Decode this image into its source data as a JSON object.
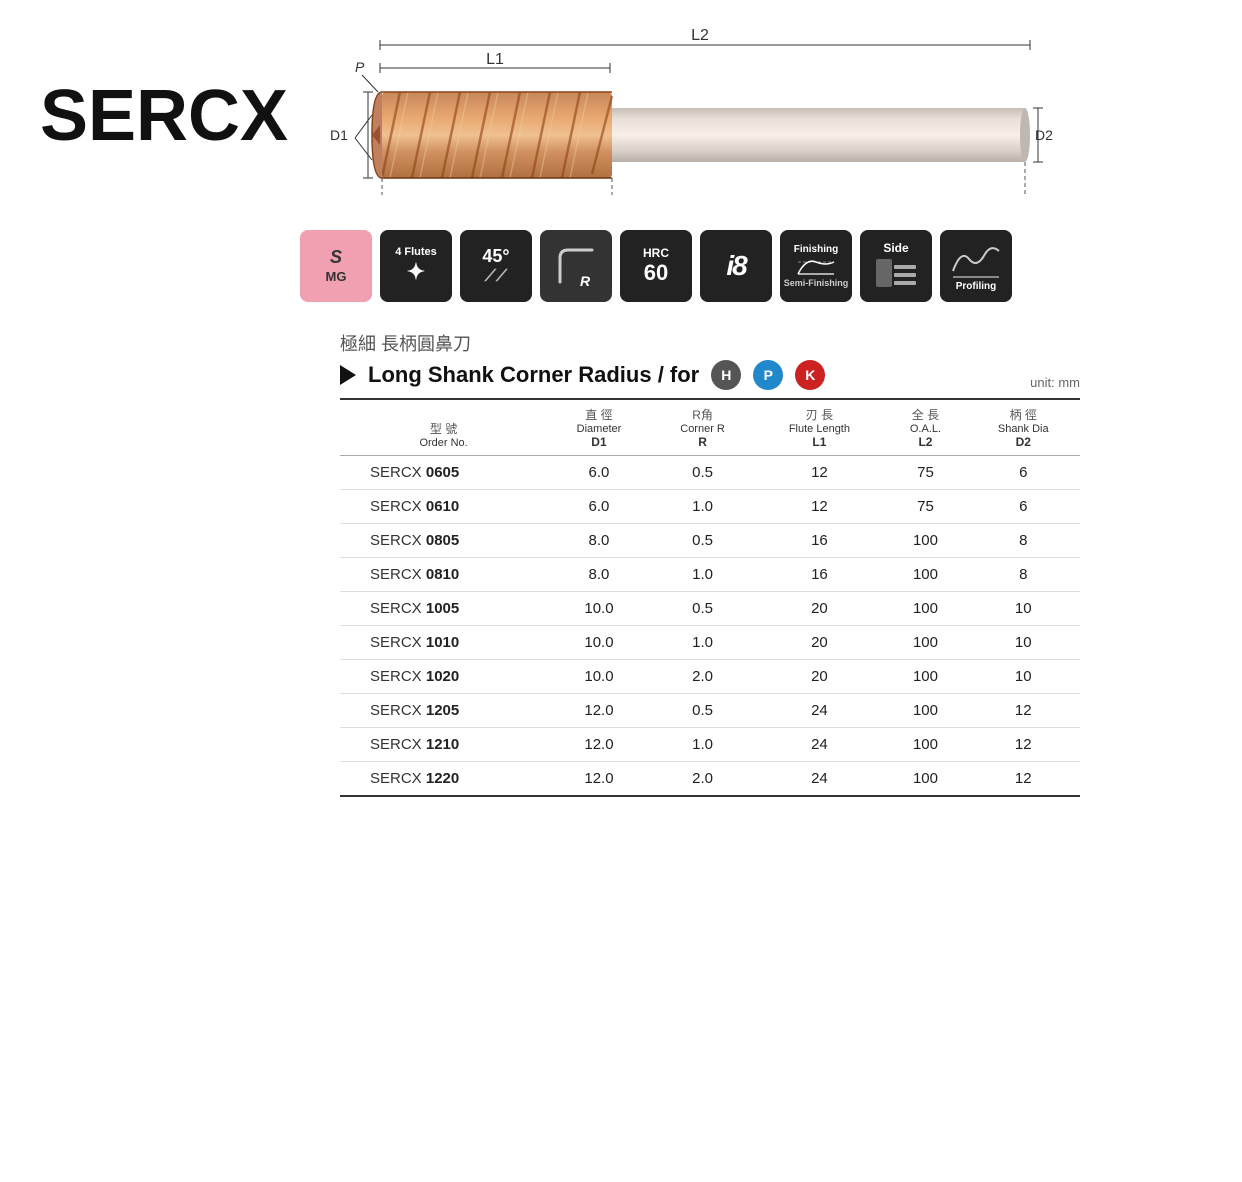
{
  "brand": "SERCX",
  "badges": [
    {
      "id": "s-mg",
      "line1": "S",
      "line2": "MG",
      "style": "pink"
    },
    {
      "id": "4-flutes",
      "line1": "4 Flutes",
      "line2": "⚙",
      "style": "dark"
    },
    {
      "id": "45deg",
      "line1": "45°",
      "line2": "//",
      "style": "dark"
    },
    {
      "id": "corner-r",
      "line1": "",
      "line2": "R",
      "style": "dark"
    },
    {
      "id": "hrc60",
      "line1": "HRC",
      "line2": "60",
      "style": "dark"
    },
    {
      "id": "i8",
      "line1": "i",
      "line2": "8",
      "style": "dark"
    },
    {
      "id": "finishing",
      "line1": "Finishing",
      "line2": "Semi-Finishing",
      "style": "dark"
    },
    {
      "id": "side",
      "line1": "Side",
      "line2": "",
      "style": "dark"
    },
    {
      "id": "profiling",
      "line1": "Profiling",
      "line2": "",
      "style": "dark"
    }
  ],
  "chinese_title": "極細  長柄圓鼻刀",
  "product_title": "Long Shank Corner Radius / for",
  "circles": [
    "H",
    "P",
    "K"
  ],
  "unit": "unit: mm",
  "table": {
    "columns": [
      {
        "zh": "型 號",
        "en": "Order No.",
        "sub": ""
      },
      {
        "zh": "直 徑",
        "en": "Diameter",
        "sub": "D1"
      },
      {
        "zh": "R角",
        "en": "Corner R",
        "sub": "R"
      },
      {
        "zh": "刃 長",
        "en": "Flute Length",
        "sub": "L1"
      },
      {
        "zh": "全 長",
        "en": "O.A.L.",
        "sub": "L2"
      },
      {
        "zh": "柄 徑",
        "en": "Shank Dia",
        "sub": "D2"
      }
    ],
    "rows": [
      {
        "prefix": "SERCX ",
        "bold": "0605",
        "d1": "6.0",
        "r": "0.5",
        "l1": "12",
        "l2": "75",
        "d2": "6"
      },
      {
        "prefix": "SERCX ",
        "bold": "0610",
        "d1": "6.0",
        "r": "1.0",
        "l1": "12",
        "l2": "75",
        "d2": "6"
      },
      {
        "prefix": "SERCX ",
        "bold": "0805",
        "d1": "8.0",
        "r": "0.5",
        "l1": "16",
        "l2": "100",
        "d2": "8"
      },
      {
        "prefix": "SERCX ",
        "bold": "0810",
        "d1": "8.0",
        "r": "1.0",
        "l1": "16",
        "l2": "100",
        "d2": "8"
      },
      {
        "prefix": "SERCX ",
        "bold": "1005",
        "d1": "10.0",
        "r": "0.5",
        "l1": "20",
        "l2": "100",
        "d2": "10"
      },
      {
        "prefix": "SERCX ",
        "bold": "1010",
        "d1": "10.0",
        "r": "1.0",
        "l1": "20",
        "l2": "100",
        "d2": "10"
      },
      {
        "prefix": "SERCX ",
        "bold": "1020",
        "d1": "10.0",
        "r": "2.0",
        "l1": "20",
        "l2": "100",
        "d2": "10"
      },
      {
        "prefix": "SERCX ",
        "bold": "1205",
        "d1": "12.0",
        "r": "0.5",
        "l1": "24",
        "l2": "100",
        "d2": "12"
      },
      {
        "prefix": "SERCX ",
        "bold": "1210",
        "d1": "12.0",
        "r": "1.0",
        "l1": "24",
        "l2": "100",
        "d2": "12"
      },
      {
        "prefix": "SERCX ",
        "bold": "1220",
        "d1": "12.0",
        "r": "2.0",
        "l1": "24",
        "l2": "100",
        "d2": "12"
      }
    ]
  },
  "diagram": {
    "p_label": "P",
    "d1_label": "D1",
    "d2_label": "D2",
    "l1_label": "L1",
    "l2_label": "L2"
  }
}
